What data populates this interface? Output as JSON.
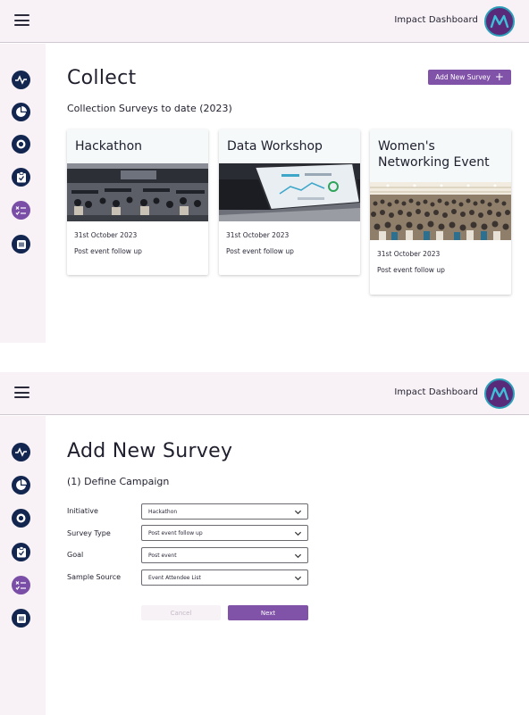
{
  "app": {
    "title": "Impact Dashboard",
    "colors": {
      "accent": "#8052a8",
      "navy": "#13264f",
      "topbar": "#f8f1f6",
      "avatar_ring": "#2b9fb8"
    }
  },
  "sidebar": {
    "items": [
      {
        "icon": "activity-icon"
      },
      {
        "icon": "pie-chart-icon"
      },
      {
        "icon": "target-icon"
      },
      {
        "icon": "clipboard-icon"
      },
      {
        "icon": "checklist-icon",
        "active": true
      },
      {
        "icon": "message-icon"
      }
    ]
  },
  "collect": {
    "title": "Collect",
    "subtitle": "Collection Surveys to date (2023)",
    "add_button": "Add New Survey",
    "add_icon": "+",
    "cards": [
      {
        "title": "Hackathon",
        "date": "31st October 2023",
        "type": "Post event follow up"
      },
      {
        "title": "Data Workshop",
        "date": "31st October 2023",
        "type": "Post event follow up"
      },
      {
        "title": "Women's Networking Event",
        "date": "31st October 2023",
        "type": "Post event follow up"
      }
    ]
  },
  "add_survey": {
    "title": "Add New Survey",
    "step": "(1) Define Campaign",
    "fields": [
      {
        "label": "Initiative",
        "value": "Hackathon"
      },
      {
        "label": "Survey Type",
        "value": "Post event follow up"
      },
      {
        "label": "Goal",
        "value": "Post event"
      },
      {
        "label": "Sample Source",
        "value": "Event Attendee List"
      }
    ],
    "cancel_label": "Cancel",
    "next_label": "Next"
  }
}
